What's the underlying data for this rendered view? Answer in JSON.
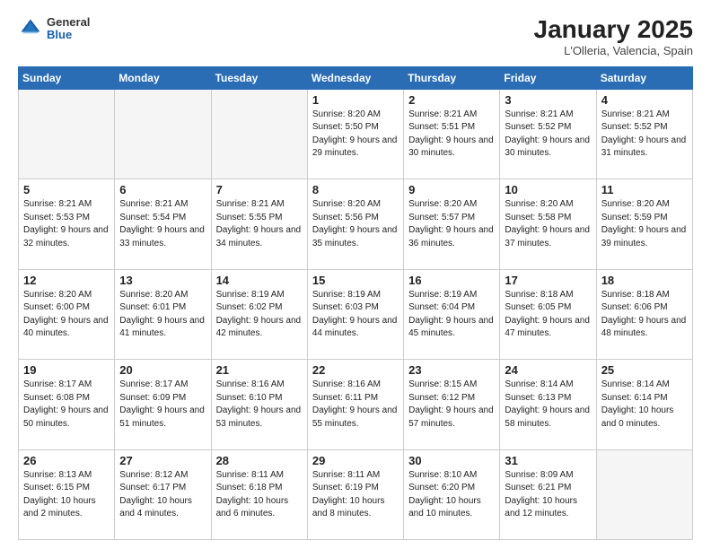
{
  "header": {
    "logo_general": "General",
    "logo_blue": "Blue",
    "title": "January 2025",
    "subtitle": "L'Olleria, Valencia, Spain"
  },
  "days_of_week": [
    "Sunday",
    "Monday",
    "Tuesday",
    "Wednesday",
    "Thursday",
    "Friday",
    "Saturday"
  ],
  "weeks": [
    [
      {
        "day": "",
        "info": ""
      },
      {
        "day": "",
        "info": ""
      },
      {
        "day": "",
        "info": ""
      },
      {
        "day": "1",
        "info": "Sunrise: 8:20 AM\nSunset: 5:50 PM\nDaylight: 9 hours\nand 29 minutes."
      },
      {
        "day": "2",
        "info": "Sunrise: 8:21 AM\nSunset: 5:51 PM\nDaylight: 9 hours\nand 30 minutes."
      },
      {
        "day": "3",
        "info": "Sunrise: 8:21 AM\nSunset: 5:52 PM\nDaylight: 9 hours\nand 30 minutes."
      },
      {
        "day": "4",
        "info": "Sunrise: 8:21 AM\nSunset: 5:52 PM\nDaylight: 9 hours\nand 31 minutes."
      }
    ],
    [
      {
        "day": "5",
        "info": "Sunrise: 8:21 AM\nSunset: 5:53 PM\nDaylight: 9 hours\nand 32 minutes."
      },
      {
        "day": "6",
        "info": "Sunrise: 8:21 AM\nSunset: 5:54 PM\nDaylight: 9 hours\nand 33 minutes."
      },
      {
        "day": "7",
        "info": "Sunrise: 8:21 AM\nSunset: 5:55 PM\nDaylight: 9 hours\nand 34 minutes."
      },
      {
        "day": "8",
        "info": "Sunrise: 8:20 AM\nSunset: 5:56 PM\nDaylight: 9 hours\nand 35 minutes."
      },
      {
        "day": "9",
        "info": "Sunrise: 8:20 AM\nSunset: 5:57 PM\nDaylight: 9 hours\nand 36 minutes."
      },
      {
        "day": "10",
        "info": "Sunrise: 8:20 AM\nSunset: 5:58 PM\nDaylight: 9 hours\nand 37 minutes."
      },
      {
        "day": "11",
        "info": "Sunrise: 8:20 AM\nSunset: 5:59 PM\nDaylight: 9 hours\nand 39 minutes."
      }
    ],
    [
      {
        "day": "12",
        "info": "Sunrise: 8:20 AM\nSunset: 6:00 PM\nDaylight: 9 hours\nand 40 minutes."
      },
      {
        "day": "13",
        "info": "Sunrise: 8:20 AM\nSunset: 6:01 PM\nDaylight: 9 hours\nand 41 minutes."
      },
      {
        "day": "14",
        "info": "Sunrise: 8:19 AM\nSunset: 6:02 PM\nDaylight: 9 hours\nand 42 minutes."
      },
      {
        "day": "15",
        "info": "Sunrise: 8:19 AM\nSunset: 6:03 PM\nDaylight: 9 hours\nand 44 minutes."
      },
      {
        "day": "16",
        "info": "Sunrise: 8:19 AM\nSunset: 6:04 PM\nDaylight: 9 hours\nand 45 minutes."
      },
      {
        "day": "17",
        "info": "Sunrise: 8:18 AM\nSunset: 6:05 PM\nDaylight: 9 hours\nand 47 minutes."
      },
      {
        "day": "18",
        "info": "Sunrise: 8:18 AM\nSunset: 6:06 PM\nDaylight: 9 hours\nand 48 minutes."
      }
    ],
    [
      {
        "day": "19",
        "info": "Sunrise: 8:17 AM\nSunset: 6:08 PM\nDaylight: 9 hours\nand 50 minutes."
      },
      {
        "day": "20",
        "info": "Sunrise: 8:17 AM\nSunset: 6:09 PM\nDaylight: 9 hours\nand 51 minutes."
      },
      {
        "day": "21",
        "info": "Sunrise: 8:16 AM\nSunset: 6:10 PM\nDaylight: 9 hours\nand 53 minutes."
      },
      {
        "day": "22",
        "info": "Sunrise: 8:16 AM\nSunset: 6:11 PM\nDaylight: 9 hours\nand 55 minutes."
      },
      {
        "day": "23",
        "info": "Sunrise: 8:15 AM\nSunset: 6:12 PM\nDaylight: 9 hours\nand 57 minutes."
      },
      {
        "day": "24",
        "info": "Sunrise: 8:14 AM\nSunset: 6:13 PM\nDaylight: 9 hours\nand 58 minutes."
      },
      {
        "day": "25",
        "info": "Sunrise: 8:14 AM\nSunset: 6:14 PM\nDaylight: 10 hours\nand 0 minutes."
      }
    ],
    [
      {
        "day": "26",
        "info": "Sunrise: 8:13 AM\nSunset: 6:15 PM\nDaylight: 10 hours\nand 2 minutes."
      },
      {
        "day": "27",
        "info": "Sunrise: 8:12 AM\nSunset: 6:17 PM\nDaylight: 10 hours\nand 4 minutes."
      },
      {
        "day": "28",
        "info": "Sunrise: 8:11 AM\nSunset: 6:18 PM\nDaylight: 10 hours\nand 6 minutes."
      },
      {
        "day": "29",
        "info": "Sunrise: 8:11 AM\nSunset: 6:19 PM\nDaylight: 10 hours\nand 8 minutes."
      },
      {
        "day": "30",
        "info": "Sunrise: 8:10 AM\nSunset: 6:20 PM\nDaylight: 10 hours\nand 10 minutes."
      },
      {
        "day": "31",
        "info": "Sunrise: 8:09 AM\nSunset: 6:21 PM\nDaylight: 10 hours\nand 12 minutes."
      },
      {
        "day": "",
        "info": ""
      }
    ]
  ]
}
